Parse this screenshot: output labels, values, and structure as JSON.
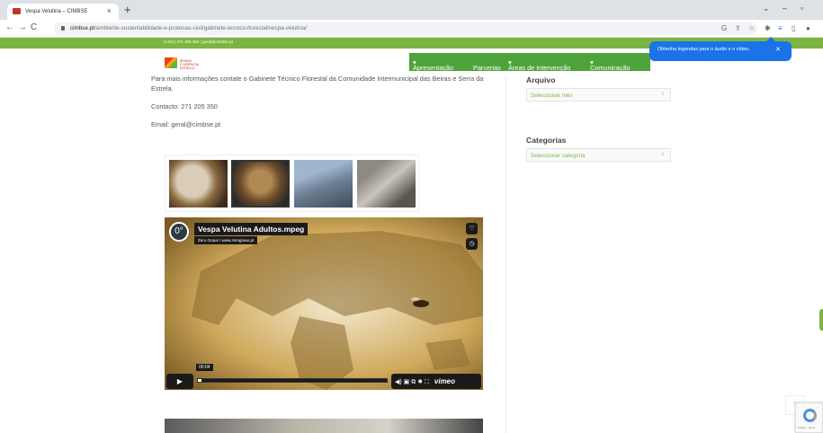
{
  "browser": {
    "tab_title": "Vespa Velutina – CIMBSE",
    "url_host": "cimbse.pt",
    "url_path": "/ambiente-sustentabilidade-e-protecao-civil/gabinete-tecnico-florestal/vespa-velutina/",
    "tooltip": "Obtenha legendas para o áudio e o vídeo.",
    "icons": [
      "back-icon",
      "forward-icon",
      "reload-icon",
      "google-icon",
      "share-icon",
      "star-icon",
      "extensions-icon",
      "media-icon",
      "sidepanel-icon",
      "profile-icon"
    ]
  },
  "site": {
    "contact_strip": "(+351) 271 205 350 | geral@cimbse.pt",
    "logo_line1": "BEIRAS",
    "logo_line2": "E SERRA DA ESTRELA",
    "nav": [
      "Apresentação",
      "Parcerias",
      "Áreas de Intervenção",
      "Comunicação"
    ],
    "brand_color": "#4ea43b"
  },
  "content": {
    "para1": "Para mais informações contate o Gabinete Técnico Florestal da Comunidade Intermunicipal das Beiras e Serra da Estrela.",
    "contact": "Contacto: 271 205 350",
    "email": "Email: geral@cimbse.pt"
  },
  "sidebar": {
    "archive_title": "Arquivo",
    "archive_select": "Seleccionar mês",
    "categories_title": "Categorias",
    "categories_select": "Seleccionar categoria"
  },
  "video": {
    "title": "Vespa Velutina Adultos.mpeg",
    "byline": "Zero Graus I www.zerograus.pt",
    "time": "00:04",
    "brand": "vimeo",
    "progress": 0.02
  }
}
